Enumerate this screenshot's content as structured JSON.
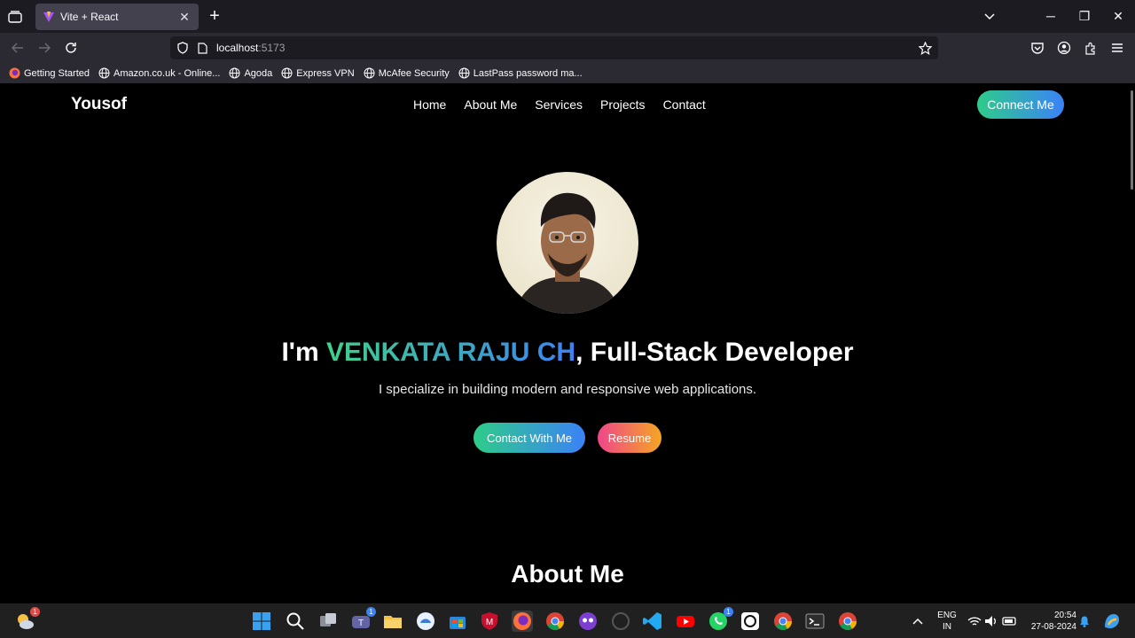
{
  "browser": {
    "tab_title": "Vite + React",
    "url_host": "localhost",
    "url_port": ":5173",
    "bookmarks": [
      {
        "label": "Getting Started",
        "icon": "firefox-icon"
      },
      {
        "label": "Amazon.co.uk - Online...",
        "icon": "globe-icon"
      },
      {
        "label": "Agoda",
        "icon": "globe-icon"
      },
      {
        "label": "Express VPN",
        "icon": "globe-icon"
      },
      {
        "label": "McAfee Security",
        "icon": "globe-icon"
      },
      {
        "label": "LastPass password ma...",
        "icon": "globe-icon"
      }
    ]
  },
  "site": {
    "brand": "Yousof",
    "nav": [
      "Home",
      "About Me",
      "Services",
      "Projects",
      "Contact"
    ],
    "connect_label": "Connect Me",
    "hero": {
      "prefix": "I'm ",
      "name": "VENKATA RAJU CH",
      "suffix": ", Full-Stack Developer",
      "subtitle": "I specialize in building modern and responsive web applications.",
      "contact_label": "Contact With Me",
      "resume_label": "Resume"
    },
    "about_title": "About Me"
  },
  "taskbar": {
    "weather_badge": "1",
    "teams_badge": "1",
    "whatsapp_badge": "1",
    "lang_top": "ENG",
    "lang_bottom": "IN",
    "time": "20:54",
    "date": "27-08-2024"
  },
  "colors": {
    "accent_green": "#2ecc8a",
    "accent_blue": "#3b82f6",
    "resume_pink": "#f0468a",
    "resume_orange": "#f5a623"
  }
}
